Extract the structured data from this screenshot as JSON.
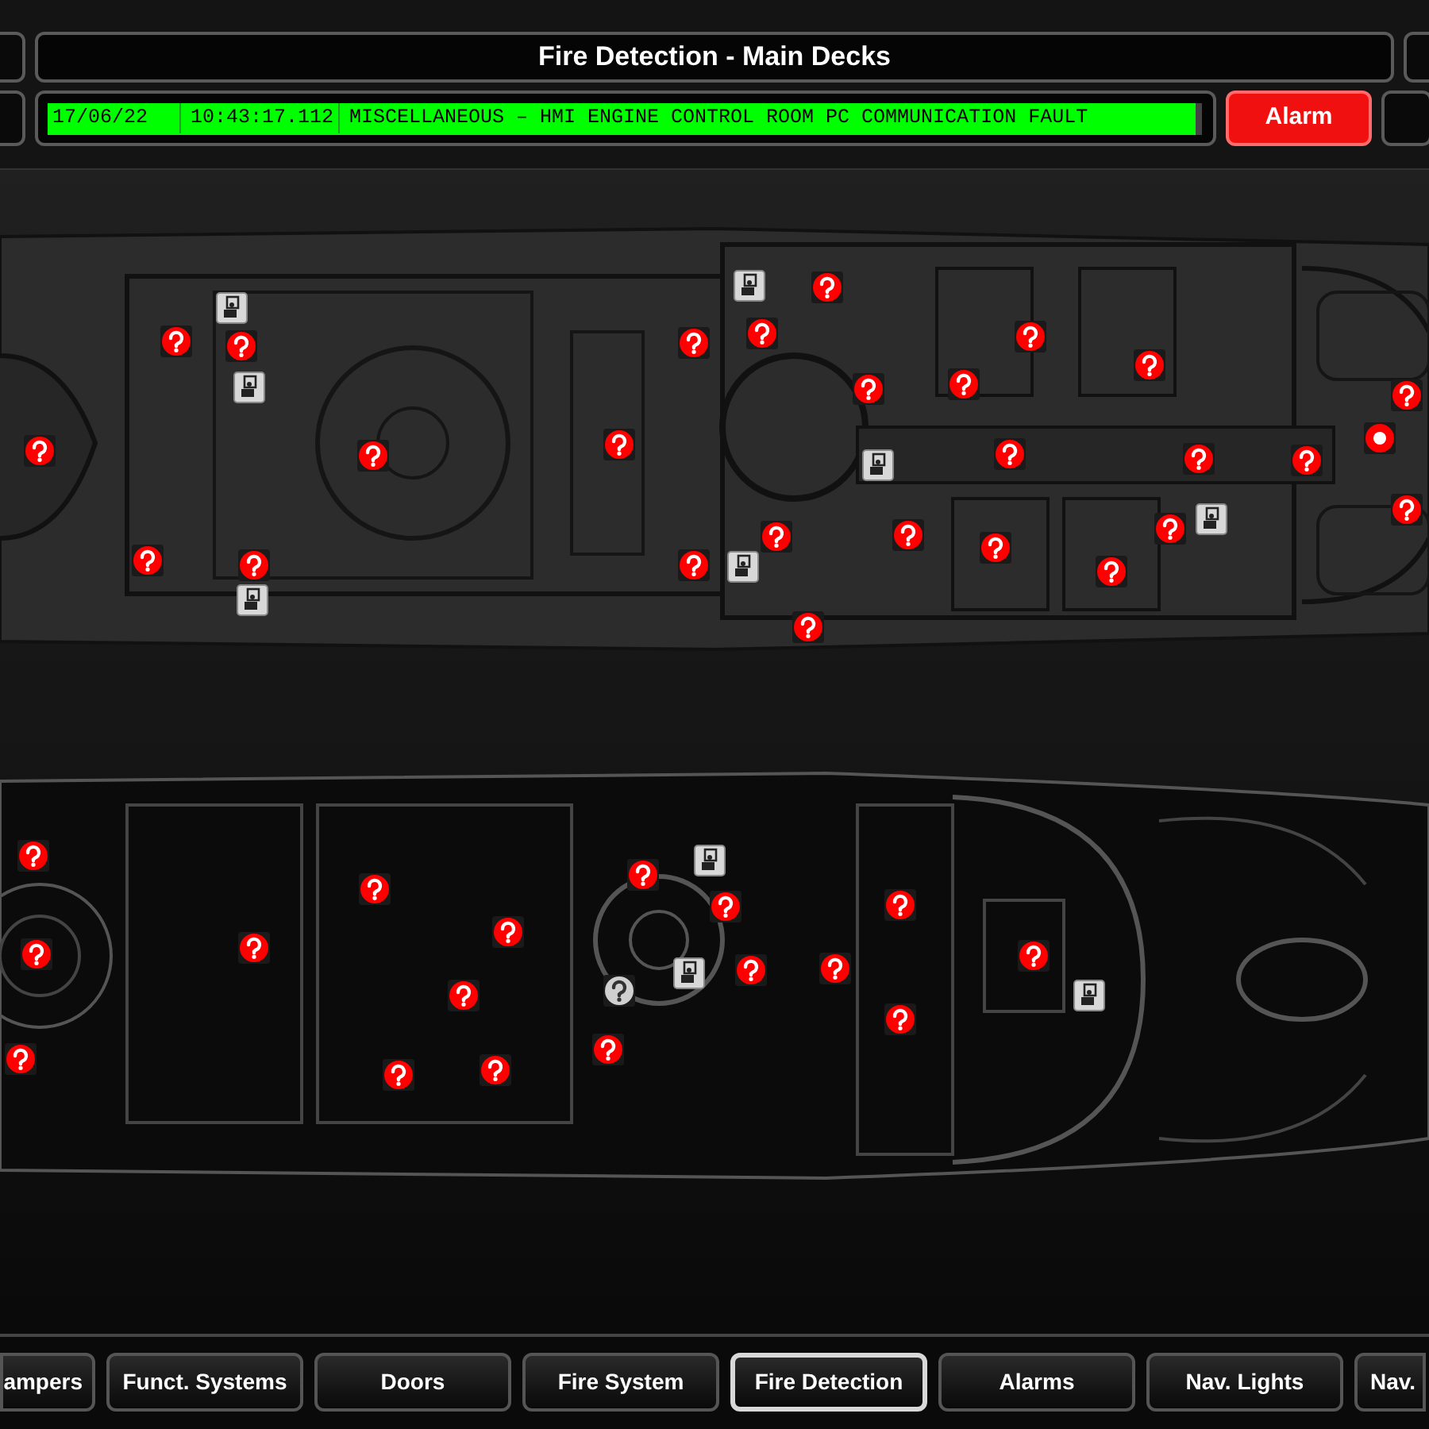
{
  "header": {
    "title": "Fire Detection - Main Decks"
  },
  "alarm_bar": {
    "date": "17/06/22",
    "time": "10:43:17.112",
    "message": "MISCELLANEOUS – HMI ENGINE CONTROL ROOM PC COMMUNICATION FAULT",
    "button": "Alarm"
  },
  "upper_deck": {
    "detectors": [
      {
        "kind": "smoke",
        "in_alarm": false,
        "isolated": false
      },
      {
        "kind": "smoke",
        "in_alarm": false,
        "isolated": false
      },
      {
        "kind": "smoke",
        "in_alarm": false,
        "isolated": false
      },
      {
        "kind": "smoke",
        "in_alarm": false,
        "isolated": false
      },
      {
        "kind": "smoke",
        "in_alarm": false,
        "isolated": false
      },
      {
        "kind": "smoke",
        "in_alarm": false,
        "isolated": false
      },
      {
        "kind": "smoke",
        "in_alarm": false,
        "isolated": false
      },
      {
        "kind": "smoke",
        "in_alarm": false,
        "isolated": false
      },
      {
        "kind": "smoke",
        "in_alarm": false,
        "isolated": false
      },
      {
        "kind": "smoke",
        "in_alarm": false,
        "isolated": false
      },
      {
        "kind": "smoke",
        "in_alarm": false,
        "isolated": false
      },
      {
        "kind": "smoke",
        "in_alarm": false,
        "isolated": false
      },
      {
        "kind": "smoke",
        "in_alarm": false,
        "isolated": false
      },
      {
        "kind": "smoke",
        "in_alarm": false,
        "isolated": false
      },
      {
        "kind": "smoke",
        "in_alarm": false,
        "isolated": false
      },
      {
        "kind": "smoke",
        "in_alarm": false,
        "isolated": false
      },
      {
        "kind": "smoke",
        "in_alarm": false,
        "isolated": false
      },
      {
        "kind": "smoke",
        "in_alarm": false,
        "isolated": false
      },
      {
        "kind": "smoke",
        "in_alarm": false,
        "isolated": false
      },
      {
        "kind": "smoke",
        "in_alarm": false,
        "isolated": false
      },
      {
        "kind": "smoke",
        "in_alarm": false,
        "isolated": false
      },
      {
        "kind": "smoke",
        "in_alarm": false,
        "isolated": false
      },
      {
        "kind": "smoke",
        "in_alarm": false,
        "isolated": false
      },
      {
        "kind": "smoke",
        "in_alarm": false,
        "isolated": false
      },
      {
        "kind": "smoke",
        "in_alarm": false,
        "isolated": false
      },
      {
        "kind": "smoke",
        "in_alarm": false,
        "isolated": false
      },
      {
        "kind": "smoke",
        "in_alarm": true,
        "isolated": false
      },
      {
        "kind": "call_point",
        "in_alarm": false,
        "isolated": false
      },
      {
        "kind": "call_point",
        "in_alarm": false,
        "isolated": false
      },
      {
        "kind": "call_point",
        "in_alarm": false,
        "isolated": false
      },
      {
        "kind": "call_point",
        "in_alarm": false,
        "isolated": false
      },
      {
        "kind": "call_point",
        "in_alarm": false,
        "isolated": false
      },
      {
        "kind": "call_point",
        "in_alarm": false,
        "isolated": false
      },
      {
        "kind": "call_point",
        "in_alarm": false,
        "isolated": false
      }
    ]
  },
  "lower_deck": {
    "detectors": [
      {
        "kind": "smoke",
        "in_alarm": false,
        "isolated": false
      },
      {
        "kind": "smoke",
        "in_alarm": false,
        "isolated": false
      },
      {
        "kind": "smoke",
        "in_alarm": false,
        "isolated": false
      },
      {
        "kind": "smoke",
        "in_alarm": false,
        "isolated": false
      },
      {
        "kind": "smoke",
        "in_alarm": false,
        "isolated": false
      },
      {
        "kind": "smoke",
        "in_alarm": false,
        "isolated": false
      },
      {
        "kind": "smoke",
        "in_alarm": false,
        "isolated": false
      },
      {
        "kind": "smoke",
        "in_alarm": false,
        "isolated": false
      },
      {
        "kind": "smoke",
        "in_alarm": false,
        "isolated": false
      },
      {
        "kind": "smoke",
        "in_alarm": false,
        "isolated": false
      },
      {
        "kind": "smoke",
        "in_alarm": false,
        "isolated": false
      },
      {
        "kind": "smoke",
        "in_alarm": false,
        "isolated": false
      },
      {
        "kind": "smoke",
        "in_alarm": false,
        "isolated": false
      },
      {
        "kind": "smoke",
        "in_alarm": false,
        "isolated": false
      },
      {
        "kind": "smoke",
        "in_alarm": false,
        "isolated": false
      },
      {
        "kind": "smoke",
        "in_alarm": false,
        "isolated": false
      },
      {
        "kind": "smoke",
        "in_alarm": false,
        "isolated": false
      },
      {
        "kind": "smoke",
        "in_alarm": false,
        "isolated": true
      },
      {
        "kind": "call_point",
        "in_alarm": false,
        "isolated": false
      },
      {
        "kind": "call_point",
        "in_alarm": false,
        "isolated": false
      },
      {
        "kind": "call_point",
        "in_alarm": false,
        "isolated": false
      }
    ]
  },
  "nav_tabs": [
    {
      "label": "ampers",
      "selected": false
    },
    {
      "label": "Funct. Systems",
      "selected": false
    },
    {
      "label": "Doors",
      "selected": false
    },
    {
      "label": "Fire System",
      "selected": false
    },
    {
      "label": "Fire Detection",
      "selected": true
    },
    {
      "label": "Alarms",
      "selected": false
    },
    {
      "label": "Nav. Lights",
      "selected": false
    },
    {
      "label": "Nav.",
      "selected": false
    }
  ]
}
